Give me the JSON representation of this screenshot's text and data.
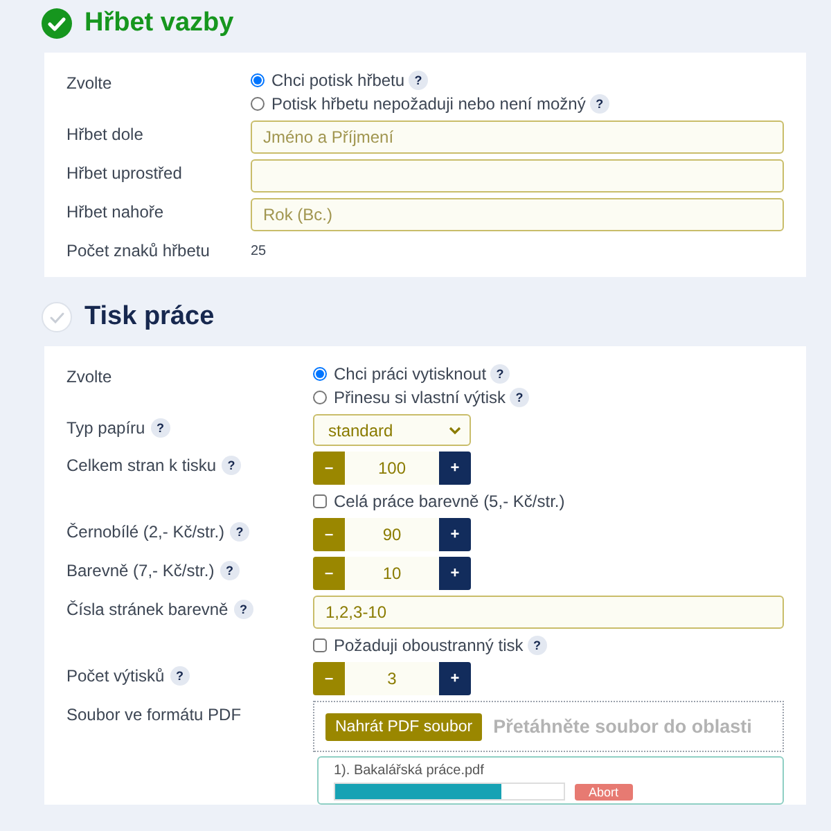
{
  "sections": [
    {
      "title": "Hřbet vazby",
      "done": true,
      "rows": [
        {
          "kind": "radios",
          "label": "Zvolte",
          "options": [
            {
              "text": "Chci potisk hřbetu",
              "help": "?",
              "selected": true
            },
            {
              "text": "Potisk hřbetu nepožaduji nebo není možný",
              "help": "?",
              "selected": false
            }
          ]
        },
        {
          "kind": "text",
          "label": "Hřbet dole",
          "placeholder": "Jméno a Příjmení"
        },
        {
          "kind": "text",
          "label": "Hřbet uprostřed"
        },
        {
          "kind": "text",
          "label": "Hřbet nahoře",
          "placeholder": "Rok (Bc.)"
        },
        {
          "kind": "count",
          "label": "Počet znaků hřbetu",
          "value": "25"
        }
      ]
    },
    {
      "title": "Tisk práce",
      "done": false,
      "rows": [
        {
          "kind": "radios",
          "label": "Zvolte",
          "options": [
            {
              "text": "Chci práci vytisknout",
              "help": "?",
              "selected": true
            },
            {
              "text": "Přinesu si vlastní výtisk",
              "help": "?",
              "selected": false
            }
          ]
        },
        {
          "kind": "select",
          "label": "Typ papíru",
          "help": "?",
          "value": "standard"
        },
        {
          "kind": "stepper",
          "label": "Celkem stran k tisku",
          "help": "?",
          "value": "100",
          "minus": "–",
          "plus": "+"
        },
        {
          "kind": "checkbox",
          "text": "Celá práce barevně (5,- Kč/str.)",
          "checked": false
        },
        {
          "kind": "stepper",
          "label": "Černobílé (2,- Kč/str.)",
          "help": "?",
          "value": "90",
          "minus": "–",
          "plus": "+"
        },
        {
          "kind": "stepper",
          "label": "Barevně (7,- Kč/str.)",
          "help": "?",
          "value": "10",
          "minus": "–",
          "plus": "+"
        },
        {
          "kind": "text",
          "label": "Čísla stránek barevně",
          "help": "?",
          "value": "1,2,3-10"
        },
        {
          "kind": "checkbox",
          "text": "Požaduji oboustranný tisk",
          "help": "?",
          "checked": false
        },
        {
          "kind": "stepper",
          "label": "Počet výtisků",
          "help": "?",
          "value": "3",
          "minus": "–",
          "plus": "+"
        },
        {
          "kind": "upload",
          "label": "Soubor ve formátu PDF",
          "button": "Nahrát PDF soubor",
          "hint": "Přetáhněte soubor do oblasti",
          "files": [
            {
              "name": "1). Bakalářská práce.pdf",
              "level": 0.73,
              "action": "Abort"
            }
          ]
        }
      ]
    }
  ]
}
